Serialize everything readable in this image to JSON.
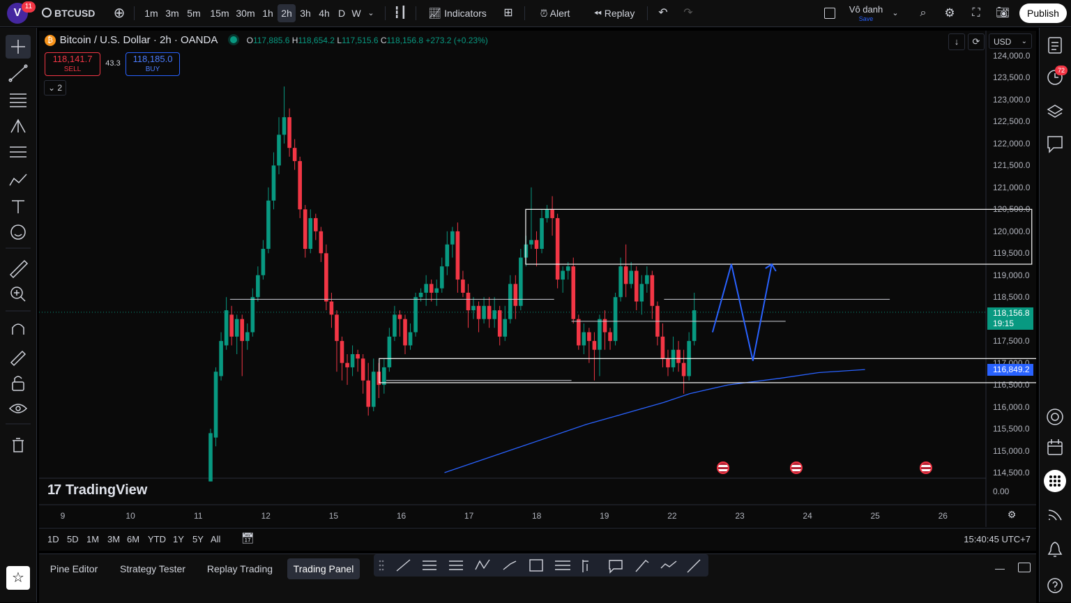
{
  "app": {
    "avatar_letter": "V",
    "notification_count": "11",
    "symbol": "BTCUSD",
    "timeframes": [
      "1m",
      "3m",
      "5m",
      "15m",
      "30m",
      "1h",
      "2h",
      "3h",
      "4h",
      "D",
      "W"
    ],
    "active_timeframe": "2h",
    "indicators_label": "Indicators",
    "alert_label": "Alert",
    "replay_label": "Replay",
    "layout_name": "Vô danh",
    "layout_save": "Save",
    "publish_label": "Publish"
  },
  "legend": {
    "title": "Bitcoin / U.S. Dollar · 2h · OANDA",
    "o_label": "O",
    "o_value": "117,885.6",
    "h_label": "H",
    "h_value": "118,654.2",
    "l_label": "L",
    "l_value": "117,515.6",
    "c_label": "C",
    "c_value": "118,156.8",
    "change": "+273.2 (+0.23%)",
    "sell_price": "118,141.7",
    "sell_label": "SELL",
    "spread": "43.3",
    "buy_price": "118,185.0",
    "buy_label": "BUY",
    "indicator_count": "2"
  },
  "price_axis": {
    "currency": "USD",
    "ticks": [
      "124,000.0",
      "123,500.0",
      "123,000.0",
      "122,500.0",
      "122,000.0",
      "121,500.0",
      "121,000.0",
      "120,500.0",
      "120,000.0",
      "119,500.0",
      "119,000.0",
      "118,500.0",
      "117,500.0",
      "117,000.0",
      "116,500.0",
      "116,000.0",
      "115,500.0",
      "115,000.0",
      "114,500.0"
    ],
    "last_price": "118,156.8",
    "countdown": "19:15",
    "ma_price": "116,849.2",
    "volume_zero": "0.00"
  },
  "time_axis": {
    "ticks": [
      "9",
      "10",
      "11",
      "12",
      "15",
      "16",
      "17",
      "18",
      "19",
      "22",
      "23",
      "24",
      "25",
      "26"
    ]
  },
  "watermark": "TradingView",
  "range_buttons": [
    "1D",
    "5D",
    "1M",
    "3M",
    "6M",
    "YTD",
    "1Y",
    "5Y",
    "All"
  ],
  "clock": "15:40:45 UTC+7",
  "panel_tabs": [
    "Pine Editor",
    "Strategy Tester",
    "Replay Trading",
    "Trading Panel"
  ],
  "active_panel_tab": "Trading Panel",
  "right_sidebar": {
    "badge": "72"
  },
  "colors": {
    "up": "#089981",
    "down": "#f23645",
    "ma": "#2962ff",
    "projection": "#2962ff",
    "box": "#ffffff"
  },
  "chart_data": {
    "type": "candlestick",
    "instrument": "Bitcoin / U.S. Dollar",
    "interval": "2h",
    "ylim": [
      114400,
      124100
    ],
    "candles": [
      [
        114300,
        115400,
        114300,
        115500
      ],
      [
        115300,
        116800,
        115100,
        116900
      ],
      [
        116700,
        117500,
        116600,
        117700
      ],
      [
        117400,
        118200,
        117300,
        118500
      ],
      [
        118100,
        117600,
        117400,
        118300
      ],
      [
        117600,
        118000,
        117200,
        118100
      ],
      [
        118000,
        117500,
        116700,
        118100
      ],
      [
        117500,
        117700,
        117300,
        117900
      ],
      [
        117700,
        118500,
        117600,
        118700
      ],
      [
        118500,
        119000,
        118400,
        119200
      ],
      [
        119000,
        119600,
        118900,
        119800
      ],
      [
        119600,
        120700,
        119500,
        121000
      ],
      [
        120700,
        121500,
        120500,
        121800
      ],
      [
        121500,
        122200,
        121300,
        122600
      ],
      [
        122200,
        122600,
        122000,
        123300
      ],
      [
        122600,
        121900,
        121700,
        122800
      ],
      [
        121900,
        121600,
        121400,
        122100
      ],
      [
        121600,
        120500,
        120300,
        121700
      ],
      [
        120500,
        119600,
        119400,
        120600
      ],
      [
        119600,
        120300,
        119500,
        120500
      ],
      [
        120300,
        120000,
        119800,
        120400
      ],
      [
        120000,
        119500,
        119300,
        120100
      ],
      [
        119500,
        118400,
        118200,
        119700
      ],
      [
        118400,
        118100,
        117800,
        118600
      ],
      [
        118100,
        117500,
        116800,
        118200
      ],
      [
        117500,
        117000,
        116600,
        117600
      ],
      [
        117000,
        116900,
        116500,
        117200
      ],
      [
        116900,
        117200,
        116700,
        117400
      ],
      [
        117200,
        117100,
        116800,
        117300
      ],
      [
        117100,
        116600,
        116300,
        117200
      ],
      [
        116600,
        116000,
        115800,
        117000
      ],
      [
        116000,
        116800,
        115900,
        117100
      ],
      [
        116800,
        116500,
        116200,
        117000
      ],
      [
        116500,
        116900,
        116300,
        117100
      ],
      [
        116900,
        117600,
        116800,
        117800
      ],
      [
        117600,
        118100,
        117500,
        118300
      ],
      [
        118100,
        118000,
        117600,
        118200
      ],
      [
        118000,
        117400,
        117200,
        118100
      ],
      [
        117400,
        117700,
        117300,
        117900
      ],
      [
        117700,
        118500,
        117600,
        118600
      ],
      [
        118500,
        118600,
        118400,
        118700
      ],
      [
        118600,
        118800,
        118300,
        119000
      ],
      [
        118800,
        118600,
        118400,
        118900
      ],
      [
        118600,
        118700,
        118300,
        118900
      ],
      [
        118700,
        119200,
        118600,
        119400
      ],
      [
        119200,
        119700,
        119000,
        120000
      ],
      [
        119700,
        120000,
        119400,
        120100
      ],
      [
        120000,
        118900,
        118600,
        120200
      ],
      [
        118900,
        118600,
        118500,
        119100
      ],
      [
        118600,
        118200,
        117800,
        118800
      ],
      [
        118200,
        118300,
        118000,
        118500
      ],
      [
        118300,
        118000,
        117700,
        118400
      ],
      [
        118000,
        118300,
        117900,
        118500
      ],
      [
        118300,
        118000,
        117800,
        118500
      ],
      [
        118000,
        118200,
        117800,
        118500
      ],
      [
        118200,
        117600,
        117400,
        118300
      ],
      [
        117600,
        118000,
        117500,
        118300
      ],
      [
        118000,
        118800,
        117900,
        119000
      ],
      [
        118800,
        118300,
        118000,
        119000
      ],
      [
        118300,
        119400,
        118200,
        119600
      ],
      [
        119400,
        119700,
        119200,
        119900
      ],
      [
        119700,
        119800,
        119600,
        121000
      ],
      [
        119800,
        119600,
        119200,
        120000
      ],
      [
        119600,
        120300,
        119500,
        120500
      ],
      [
        120300,
        120500,
        120200,
        120600
      ],
      [
        120500,
        120300,
        119900,
        120800
      ],
      [
        120300,
        118900,
        118700,
        120400
      ],
      [
        118900,
        119100,
        118600,
        119200
      ],
      [
        119100,
        119200,
        118900,
        119300
      ],
      [
        119200,
        118000,
        117900,
        119400
      ],
      [
        118000,
        117400,
        117300,
        118100
      ],
      [
        117400,
        117700,
        117200,
        117900
      ],
      [
        117700,
        117500,
        117000,
        117800
      ],
      [
        117500,
        117300,
        116600,
        117700
      ],
      [
        117300,
        118000,
        116700,
        118100
      ],
      [
        118000,
        117700,
        117300,
        118200
      ],
      [
        117700,
        117500,
        117300,
        117800
      ],
      [
        117500,
        118500,
        117400,
        118600
      ],
      [
        118500,
        119200,
        118400,
        119400
      ],
      [
        119200,
        118800,
        118500,
        119700
      ],
      [
        118800,
        119100,
        118700,
        119300
      ],
      [
        119100,
        118400,
        118200,
        119200
      ],
      [
        118400,
        118800,
        118100,
        119000
      ],
      [
        118800,
        119000,
        118600,
        119200
      ],
      [
        119000,
        118300,
        118000,
        119100
      ],
      [
        118300,
        117600,
        117400,
        118400
      ],
      [
        117600,
        117100,
        116900,
        117900
      ],
      [
        117100,
        116900,
        116700,
        117300
      ],
      [
        116900,
        117300,
        116800,
        117600
      ],
      [
        117300,
        117000,
        116800,
        117500
      ],
      [
        117000,
        116700,
        116300,
        117300
      ],
      [
        116700,
        117500,
        116600,
        117700
      ],
      [
        117500,
        118200,
        117400,
        118600
      ]
    ],
    "moving_average": [
      [
        95,
        114500
      ],
      [
        120,
        115000
      ],
      [
        150,
        115600
      ],
      [
        180,
        116100
      ],
      [
        190,
        116300
      ],
      [
        205,
        116500
      ],
      [
        225,
        116650
      ],
      [
        240,
        116780
      ],
      [
        258,
        116849
      ]
    ],
    "zones": [
      {
        "name": "resistance-box",
        "top": 120500,
        "bottom": 119250,
        "from": 49,
        "to": 125
      },
      {
        "name": "support-box",
        "top": 117100,
        "bottom": 116550,
        "from": 27,
        "to": 129
      }
    ],
    "levels": [
      {
        "price": 118450,
        "from": 33,
        "to": 89
      },
      {
        "price": 116600,
        "from": 60,
        "to": 92
      },
      {
        "price": 118450,
        "from": 108,
        "to": 147
      },
      {
        "price": 117950,
        "from": 92,
        "to": 129
      }
    ],
    "projection": [
      [
        117700,
        258
      ],
      [
        119250,
        265
      ],
      [
        117050,
        273
      ],
      [
        119250,
        280
      ]
    ]
  }
}
